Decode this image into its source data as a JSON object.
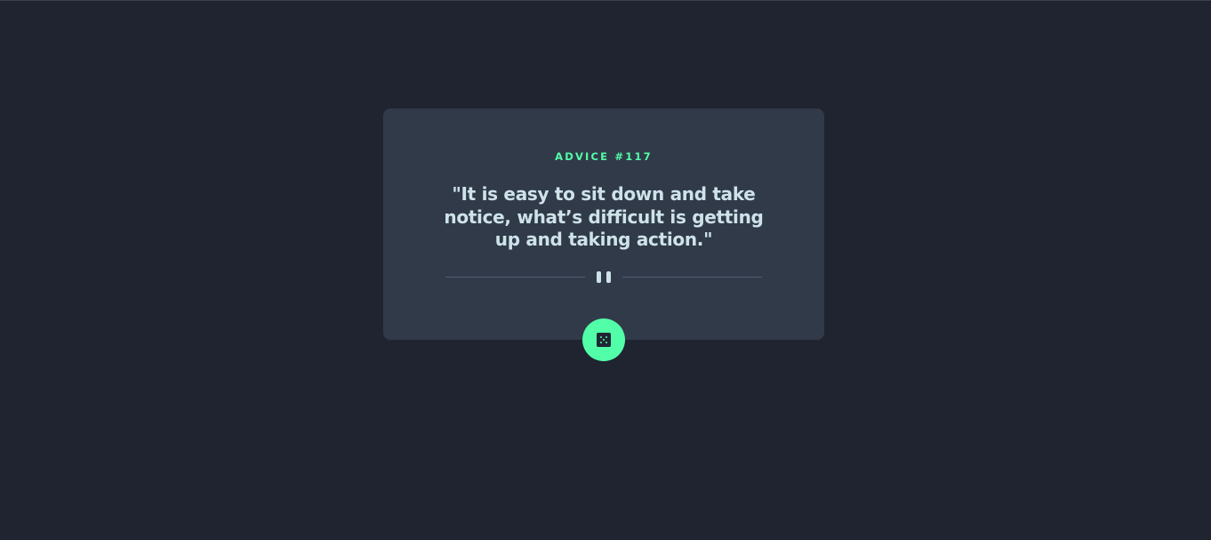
{
  "advice": {
    "id_label": "ADVICE #117",
    "quote": "\"It is easy to sit down and take notice, what’s difficult is getting up and taking action.\""
  },
  "icons": {
    "divider": "pause-icon",
    "button": "dice-icon"
  },
  "colors": {
    "background": "#1f2430",
    "card": "#313a49",
    "accent": "#52ffa8",
    "text": "#cee3e9",
    "divider_line": "#4f5d74"
  }
}
